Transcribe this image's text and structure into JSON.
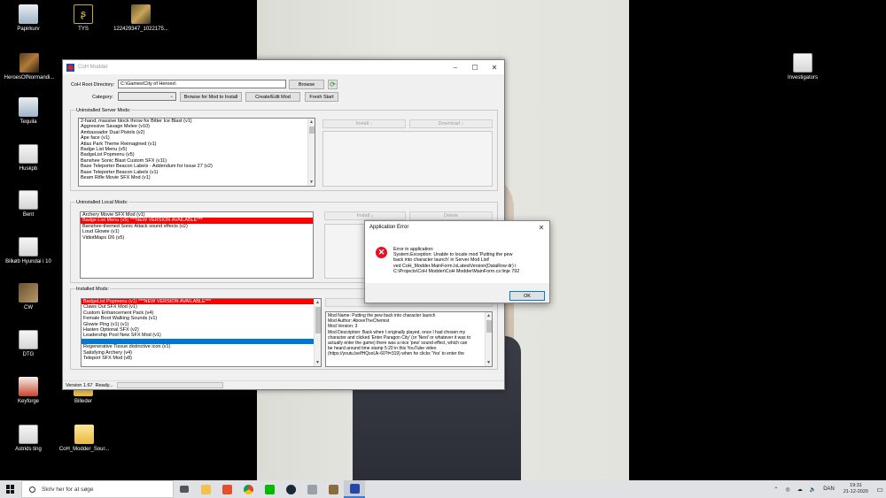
{
  "desktop": {
    "icons": [
      {
        "label": "Papirkurv",
        "icon": "recycle-bin-icon"
      },
      {
        "label": "TYS",
        "icon": "tys-logo-icon"
      },
      {
        "label": "122429347_1022175...",
        "icon": "image-file-icon"
      },
      {
        "label": "HeroesOfNormandi...",
        "icon": "game-icon"
      },
      {
        "label": "Tequila",
        "icon": "recycle-bin-icon"
      },
      {
        "label": "Huskpb",
        "icon": "document-icon"
      },
      {
        "label": "Bent",
        "icon": "document-icon"
      },
      {
        "label": "Bilkøb Hyundai i 10",
        "icon": "document-icon"
      },
      {
        "label": "CW",
        "icon": "image-file-icon"
      },
      {
        "label": "DTG",
        "icon": "document-icon"
      },
      {
        "label": "Keyforge",
        "icon": "keyforge-icon"
      },
      {
        "label": "Billeder",
        "icon": "folder-icon"
      },
      {
        "label": "Astrids ting",
        "icon": "document-icon"
      },
      {
        "label": "CoH_Modder_Sour...",
        "icon": "folder-icon"
      },
      {
        "label": "Investigators",
        "icon": "document-icon"
      }
    ]
  },
  "window": {
    "title": "CoH Modder",
    "root_dir_label": "CoH Root Directory:",
    "root_dir_value": "C:\\Games\\City of Heroes\\",
    "browse": "Browse",
    "category_label": "Category:",
    "browse_install": "Browse for Mod to Install",
    "create_edit": "Create/Edit Mod",
    "fresh_start": "Fresh Start",
    "uninstalled_server": {
      "title": "Uninstalled Server Mods:",
      "items": [
        "2-hand, massive block throw for Bitter Ice Blast (v1)",
        "Aggressive Savage Melee (v10)",
        "Ambassador Dual Pistols (v2)",
        "Ape face (v1)",
        "Atlas Park Theme Reimagined (v1)",
        "Badge List Menu (v5)",
        "BadgeList Popmenu (v5)",
        "Banshee Sonic Blast Custom SFX (v11)",
        "Base Teleporter Beacon Labels - Addendum for Issue 27 (v2)",
        "Base Teleporter Beacon Labels (v1)",
        "Beam Rifle Movie SFX Mod (v1)"
      ],
      "install": "Install ↓",
      "download": "Download ↓"
    },
    "uninstalled_local": {
      "title": "Uninstalled Local Mods:",
      "items": [
        "Archery Movie SFX Mod (v1)",
        "Badge List Menu (v5) ***NEW VERSION AVAILABLE***",
        "Banshee-themed Sonic Attack sound effects (v2)",
        "Loud Glowie (v1)",
        "VidiotMaps I26 (v5)"
      ],
      "install": "Install ↓",
      "delete": "Delete"
    },
    "installed": {
      "title": "Installed Mods:",
      "items": [
        "BadgeList Popmenu (v1) ***NEW VERSION AVAILABLE***",
        "Claws Out SFX Mod (v1)",
        "Custom Enhancement Pack (v4)",
        "Female Boot Walking Sounds (v1)",
        "Glowie Ping (v1) (v1)",
        "Hasten Optional SFX (v2)",
        "Leadership Pool New SFX Mod (v1)",
        "",
        "Regenerative Tissue distinctive icon (v1)",
        "Satisfying Archery (v4)",
        "Teleport SFX Mod (v8)"
      ],
      "description": [
        "Mod Name: Putting the pew back into character launch",
        "Mod Author: AboveTheChemist",
        "Mod Version: 3",
        "Mod Description: Back when I originally played, once I had chosen my",
        "character and clicked 'Enter Paragon City' (or 'Next' or whatever it was to",
        "actually enter the game) there was a nice 'pew' sound effect, which can",
        "be heard around time stamp 5:20 in this YouTube video",
        "(https://youtu.be/fHQsoUk-60?t=319) when he clicks 'Yes' to enter the"
      ]
    },
    "status_version": "Version 1.67",
    "status_ready": "Ready..."
  },
  "dialog": {
    "title": "Application Error",
    "message": [
      "Error in application:",
      "System.Exception: Unable to locate mod 'Putting the pew",
      "back into character launch' in Server Mod List!",
      "   ved CoH_Modder.MainForm.IsLatestVersion(DataRow dr) i",
      "C:\\Projects\\CoH Modder\\CoH Modder\\MainForm.cs:linje 792"
    ],
    "ok": "OK"
  },
  "taskbar": {
    "search_placeholder": "Skriv her for at søge",
    "apps": [
      "task-view-icon",
      "file-explorer-icon",
      "office-icon",
      "chrome-icon",
      "line-icon",
      "steam-icon",
      "app-icon",
      "game-icon",
      "coh-modder-icon"
    ],
    "language": "DAN",
    "time": "19:31",
    "date": "21-12-2020"
  }
}
